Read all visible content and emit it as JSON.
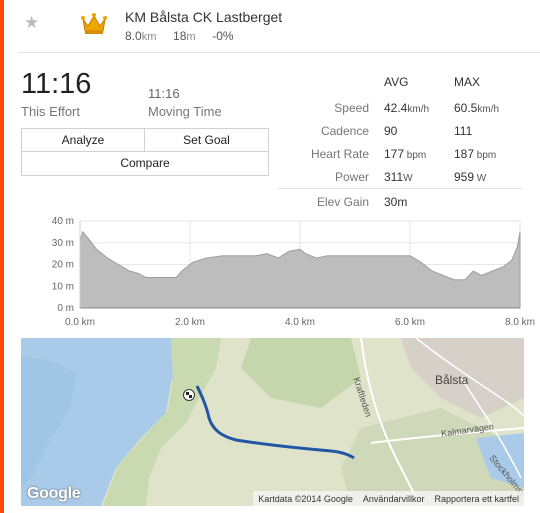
{
  "header": {
    "segment_name": "KM Bålsta CK Lastberget",
    "distance_value": "8.0",
    "distance_unit": "km",
    "elevation_value": "18",
    "elevation_unit": "m",
    "grade": "-0%",
    "icons": [
      "star-icon",
      "crown-icon"
    ]
  },
  "effort": {
    "time": "11:16",
    "time_label": "This Effort",
    "moving_time": "11:16",
    "moving_label": "Moving Time"
  },
  "buttons": {
    "analyze": "Analyze",
    "set_goal": "Set Goal",
    "compare": "Compare"
  },
  "stats": {
    "avg_header": "AVG",
    "max_header": "MAX",
    "rows": [
      {
        "label": "Speed",
        "avg_value": "42.4",
        "avg_unit": "km/h",
        "max_value": "60.5",
        "max_unit": "km/h"
      },
      {
        "label": "Cadence",
        "avg_value": "90",
        "avg_unit": "",
        "max_value": "111",
        "max_unit": ""
      },
      {
        "label": "Heart Rate",
        "avg_value": "177",
        "avg_unit": " bpm",
        "max_value": "187",
        "max_unit": " bpm"
      },
      {
        "label": "Power",
        "avg_value": "311",
        "avg_unit": "W",
        "max_value": "959",
        "max_unit": " W"
      }
    ],
    "elev_gain_label": "Elev Gain",
    "elev_gain_value": "30m"
  },
  "chart_data": {
    "type": "area",
    "x_ticks": [
      "0.0 km",
      "2.0 km",
      "4.0 km",
      "6.0 km",
      "8.0 km"
    ],
    "y_ticks": [
      "0 m",
      "10 m",
      "20 m",
      "30 m",
      "40 m"
    ],
    "xlim": [
      0,
      8
    ],
    "ylim": [
      0,
      40
    ],
    "grid": true,
    "x": [
      0,
      0.05,
      0.15,
      0.3,
      0.5,
      0.7,
      0.9,
      1.05,
      1.2,
      1.4,
      1.6,
      1.75,
      1.85,
      2.05,
      2.3,
      2.6,
      2.9,
      3.2,
      3.4,
      3.6,
      3.8,
      4.0,
      4.1,
      4.3,
      4.5,
      4.8,
      5.1,
      5.4,
      5.7,
      6.0,
      6.2,
      6.4,
      6.6,
      6.8,
      6.9,
      7.0,
      7.15,
      7.3,
      7.5,
      7.7,
      7.85,
      7.95,
      8.0
    ],
    "y": [
      31,
      35,
      32,
      27,
      23,
      20,
      17,
      16,
      14,
      14,
      14,
      14,
      17,
      21,
      23,
      24,
      24,
      24,
      25,
      23,
      26,
      27,
      25,
      23,
      24,
      24,
      24,
      24,
      24,
      24,
      21,
      17,
      15,
      13,
      13,
      13,
      17,
      15,
      17,
      19,
      22,
      28,
      35
    ]
  },
  "map": {
    "town": "Bålsta",
    "road_1": "Kraftleden",
    "road_2": "Kalmarvägen",
    "road_3": "Stockholmsv",
    "google_mark": "Google",
    "attribution": "Kartdata ©2014 Google",
    "terms": "Användarvillkor",
    "report": "Rapportera ett kartfel",
    "route_color": "#2255a4"
  }
}
